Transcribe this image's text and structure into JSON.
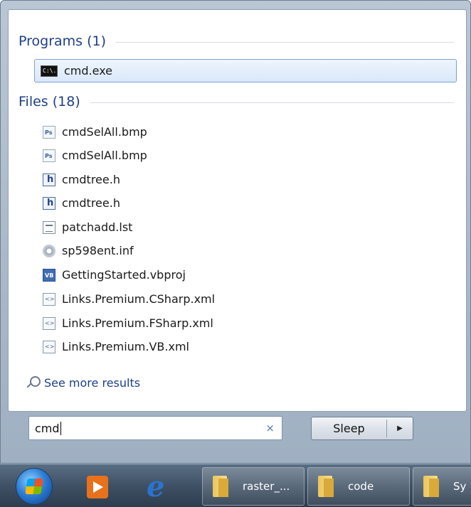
{
  "programs": {
    "header": "Programs (1)",
    "items": [
      {
        "label": "cmd.exe",
        "icon": "cmd-icon"
      }
    ]
  },
  "files": {
    "header": "Files (18)",
    "items": [
      {
        "label": "cmdSelAll.bmp",
        "icon": "bmp-file-icon"
      },
      {
        "label": "cmdSelAll.bmp",
        "icon": "bmp-file-icon"
      },
      {
        "label": "cmdtree.h",
        "icon": "h-file-icon"
      },
      {
        "label": "cmdtree.h",
        "icon": "h-file-icon"
      },
      {
        "label": "patchadd.lst",
        "icon": "text-file-icon"
      },
      {
        "label": "sp598ent.inf",
        "icon": "inf-file-icon"
      },
      {
        "label": "GettingStarted.vbproj",
        "icon": "vbproj-file-icon"
      },
      {
        "label": "Links.Premium.CSharp.xml",
        "icon": "xml-file-icon"
      },
      {
        "label": "Links.Premium.FSharp.xml",
        "icon": "xml-file-icon"
      },
      {
        "label": "Links.Premium.VB.xml",
        "icon": "xml-file-icon"
      }
    ]
  },
  "see_more": "See more results",
  "search": {
    "value": "cmd",
    "clear_icon": "×"
  },
  "sleep_button": {
    "label": "Sleep",
    "arrow": "▶"
  },
  "taskbar": {
    "windows": [
      {
        "label": "raster_..."
      },
      {
        "label": "code"
      },
      {
        "label": "Sy"
      }
    ]
  },
  "colors": {
    "header": "#1e3f87",
    "selected_border": "#7da2ce",
    "taskbar": "#3f5165"
  }
}
